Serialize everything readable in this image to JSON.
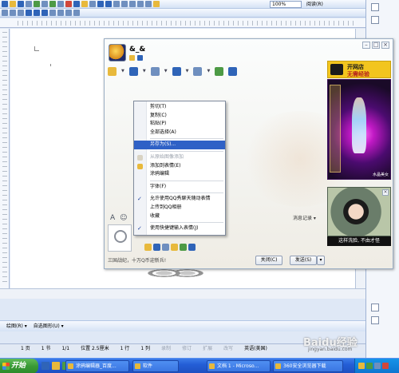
{
  "word": {
    "zoom": "100%",
    "read_mode": "阅读(R)",
    "status": {
      "page": "1 页",
      "section": "1 节",
      "page_of": "1/1",
      "position": "位置 2.5厘米",
      "line": "1 行",
      "column": "1 列",
      "record": "录制",
      "revise": "修订",
      "extend": "扩展",
      "overwrite": "改写",
      "language": "英语(美国)"
    },
    "drawbar": {
      "draw": "绘图(R) ▾",
      "autoshapes": "自选图形(U) ▾"
    }
  },
  "qq": {
    "contact_name": "&_&",
    "history_label": "消息记录 ▾",
    "footer_text": "三国战纪，十万Q币迎新兵!",
    "close_button": "关闭(C)",
    "send_button": "发送(S)",
    "send_arrow": "▾",
    "ad": {
      "top_line1": "开网店",
      "top_line2": "无需经验",
      "game_caption": "水晶美女",
      "photo_caption": "这样洗脸, 不由才怪"
    }
  },
  "context_menu": {
    "items": [
      {
        "label": "剪切(T)",
        "state": "normal"
      },
      {
        "label": "复制(C)",
        "state": "normal"
      },
      {
        "label": "粘贴(P)",
        "state": "normal"
      },
      {
        "label": "全部选择(A)",
        "state": "normal"
      },
      {
        "label": "另存为(S)...",
        "state": "highlighted"
      },
      {
        "label": "从原始图像添加",
        "state": "disabled"
      },
      {
        "label": "添加到表情(E)",
        "state": "normal"
      },
      {
        "label": "涂鸦编辑",
        "state": "normal"
      },
      {
        "label": "字体(F)",
        "state": "normal"
      },
      {
        "label": "允许使用QQ秀聊天随动表情",
        "state": "checked"
      },
      {
        "label": "上传到QQ相册",
        "state": "normal"
      },
      {
        "label": "收藏",
        "state": "normal"
      },
      {
        "label": "使用快捷键输入表情(J)",
        "state": "checked"
      }
    ]
  },
  "taskbar": {
    "start": "开始",
    "buttons": [
      "涂鸦编辑器_百度...",
      "软件",
      "文档 1 - Microso...",
      "360安全浏览器下载"
    ]
  },
  "watermark": {
    "main": "Baidu经验",
    "sub": "jingyan.baidu.com"
  }
}
